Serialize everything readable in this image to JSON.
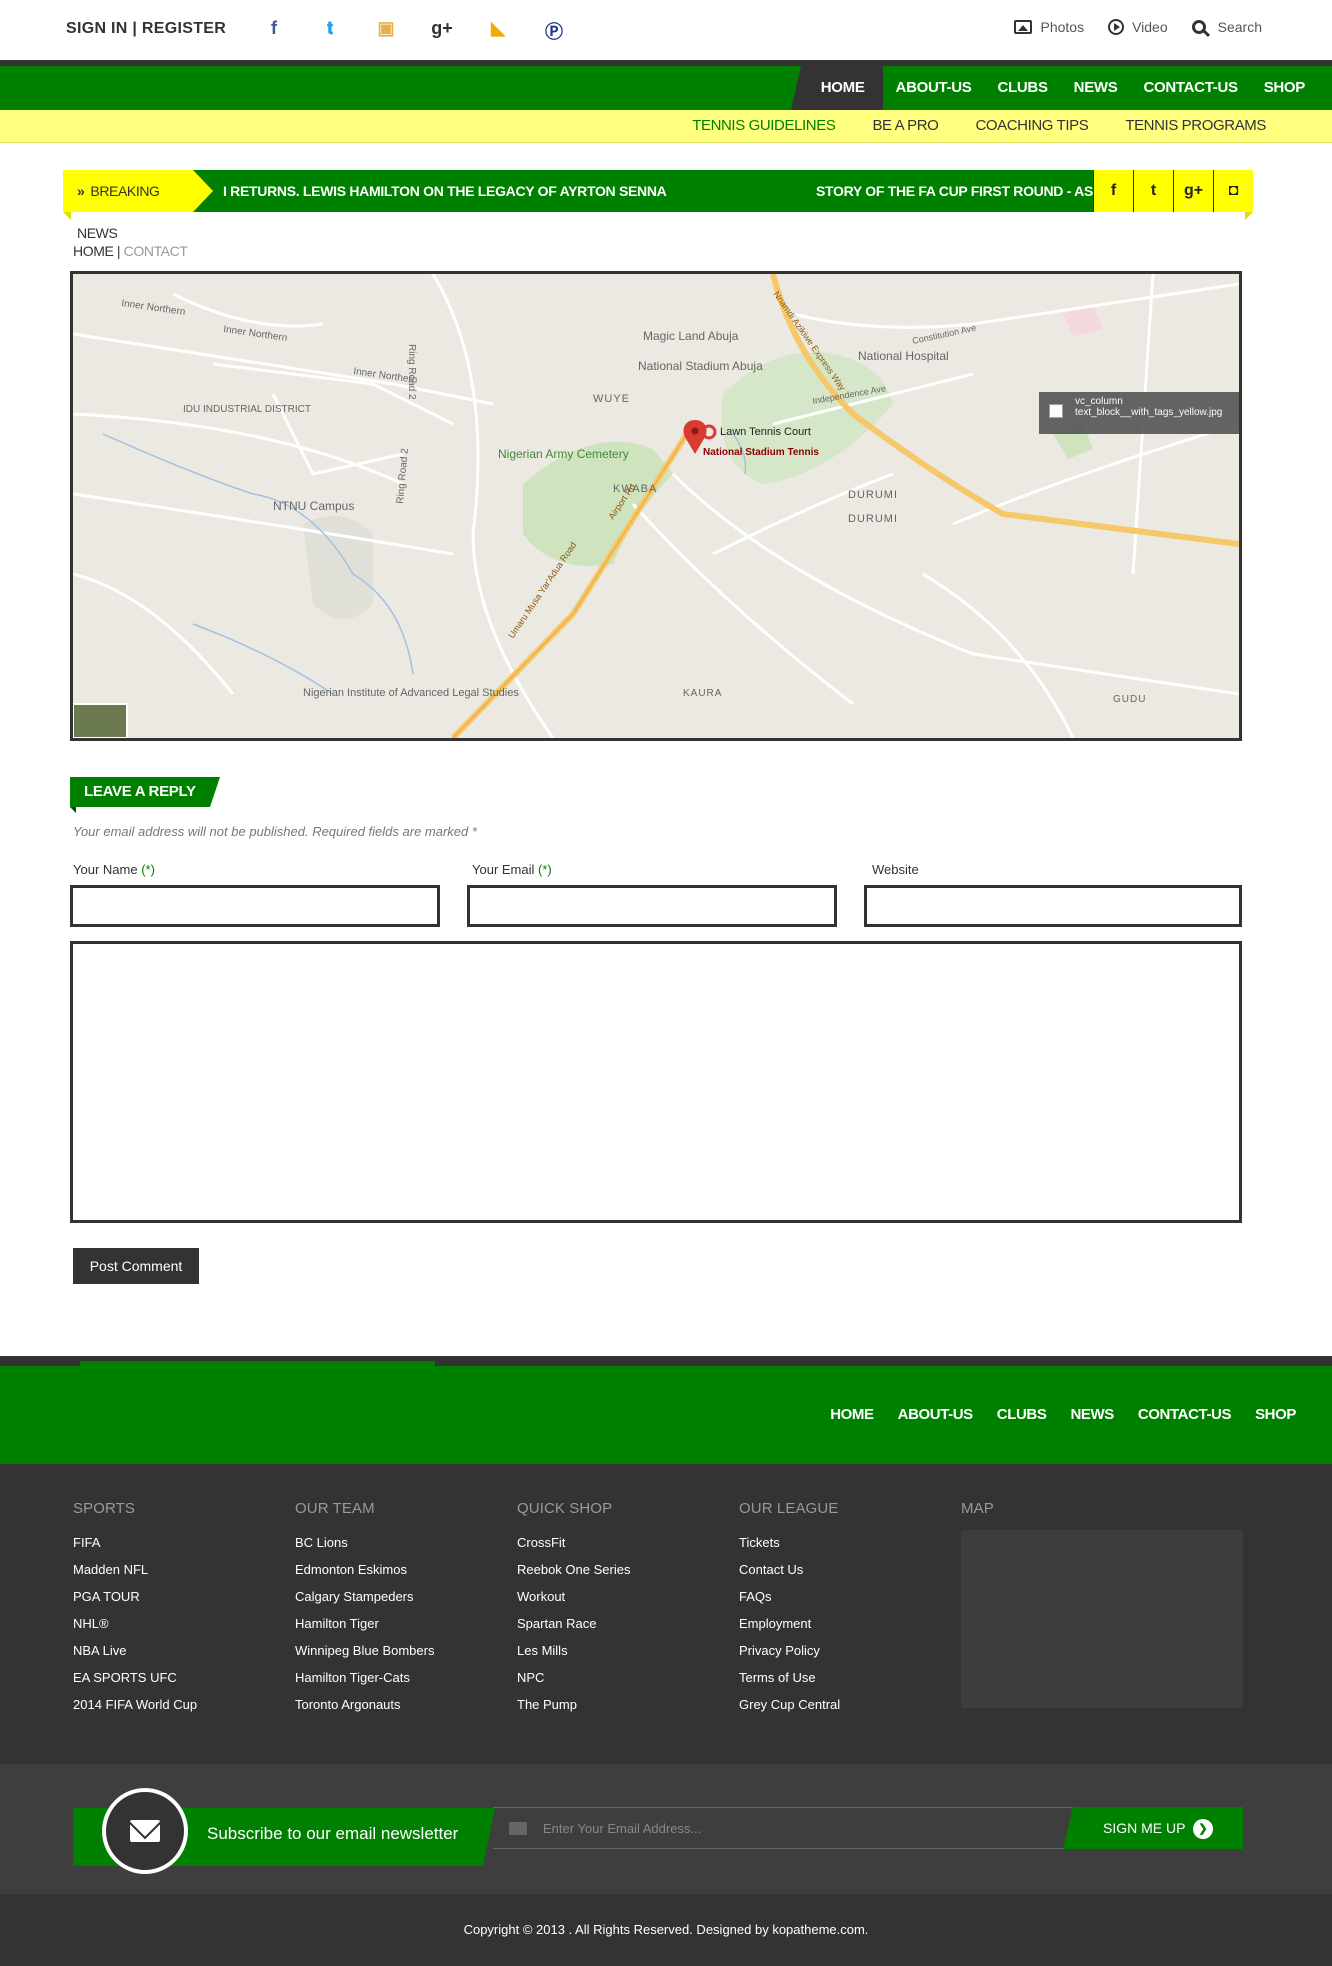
{
  "topbar": {
    "auth": "SIGN IN | REGISTER",
    "social": [
      {
        "icon": "facebook-icon",
        "glyph": "f",
        "color": "#3b5998"
      },
      {
        "icon": "twitter-icon",
        "glyph": "t",
        "color": "#1da1f2"
      },
      {
        "icon": "instagram-icon",
        "glyph": "◘",
        "color": "#e8b04a"
      },
      {
        "icon": "google-plus-icon",
        "glyph": "g+",
        "color": "#333333"
      },
      {
        "icon": "rss-icon",
        "glyph": "◣",
        "color": "#f2a900"
      },
      {
        "icon": "pinterest-icon",
        "glyph": "p",
        "color": "#1e3a8a"
      }
    ],
    "photos": "Photos",
    "video": "Video",
    "search": "Search"
  },
  "nav": {
    "items": [
      "HOME",
      "ABOUT-US",
      "CLUBS",
      "NEWS",
      "CONTACT-US",
      "SHOP"
    ],
    "active": "HOME"
  },
  "subnav": {
    "items": [
      "TENNIS GUIDELINES",
      "BE A PRO",
      "COACHING TIPS",
      "TENNIS PROGRAMS"
    ],
    "active": "TENNIS GUIDELINES"
  },
  "breaking": {
    "label": "BREAKING NEWS",
    "text1": "I RETURNS. LEWIS HAMILTON ON THE LEGACY OF AYRTON SENNA",
    "text2": "STORY OF THE FA CUP FIRST ROUND - AS",
    "social": [
      "f",
      "t",
      "g+",
      "◘"
    ]
  },
  "breadcrumb": {
    "home": "HOME",
    "sep": "|",
    "current": "CONTACT"
  },
  "map": {
    "labels": {
      "inner_northern1": "Inner Northern",
      "inner_northern2": "Inner Northern",
      "inner_northern3": "Inner Northern",
      "idu": "IDU INDUSTRIAL DISTRICT",
      "ring_road": "Ring Road 2",
      "ring_road2": "Ring Road 2",
      "ntnu": "NTNU Campus",
      "army": "Nigerian Army Cemetery",
      "wuye": "WUYE",
      "kwaba": "KWABA",
      "magic": "Magic Land Abuja",
      "stadium": "National Stadium Abuja",
      "hospital": "National Hospital",
      "lawn": "Lawn Tennis Court",
      "tennis": "National Stadium Tennis",
      "durumi1": "DURUMI",
      "durumi2": "DURUMI",
      "kaura": "KAURA",
      "gudu": "GUDU",
      "nials": "Nigerian Institute of Advanced Legal Studies",
      "airport": "Airport Rd",
      "umaru": "Umaru Musa Yar'Adua Road",
      "nnamdi": "Nnamdi Azikiwe Express Way",
      "independence": "Independence Ave",
      "constitution": "Constitution Ave"
    },
    "overlay_title": "vc_column",
    "overlay_file": "text_block__with_tags_yellow.jpg"
  },
  "reply": {
    "title": "LEAVE A REPLY",
    "note": "Your email address will not be published. Required fields are marked *",
    "name_label": "Your Name",
    "email_label": "Your Email",
    "required_mark": "(*)",
    "website_label": "Website",
    "submit": "Post Comment"
  },
  "footer_nav": [
    "HOME",
    "ABOUT-US",
    "CLUBS",
    "NEWS",
    "CONTACT-US",
    "SHOP"
  ],
  "footer_columns": [
    {
      "title": "SPORTS",
      "items": [
        "FIFA",
        "Madden NFL",
        "PGA TOUR",
        "NHL®",
        "NBA Live",
        "EA SPORTS UFC",
        "2014 FIFA World Cup"
      ]
    },
    {
      "title": "OUR TEAM",
      "items": [
        "BC Lions",
        "Edmonton Eskimos",
        "Calgary Stampeders",
        "Hamilton Tiger",
        "Winnipeg Blue Bombers",
        "Hamilton Tiger-Cats",
        "Toronto Argonauts"
      ]
    },
    {
      "title": "QUICK SHOP",
      "items": [
        "CrossFit",
        "Reebok One Series",
        "Workout",
        "Spartan Race",
        "Les Mills",
        "NPC",
        "The Pump"
      ]
    },
    {
      "title": "OUR LEAGUE",
      "items": [
        "Tickets",
        "Contact Us",
        "FAQs",
        "Employment",
        "Privacy Policy",
        "Terms of Use",
        "Grey Cup Central"
      ]
    },
    {
      "title": "MAP",
      "items": []
    }
  ],
  "newsletter": {
    "text": "Subscribe to our email newsletter",
    "placeholder": "Enter Your Email Address...",
    "button": "SIGN ME UP"
  },
  "copyright": "Copyright © 2013 . All Rights Reserved. Designed by kopatheme.com.",
  "colors": {
    "green": "#008000",
    "yellow": "#ffff80",
    "dark": "#333333"
  }
}
